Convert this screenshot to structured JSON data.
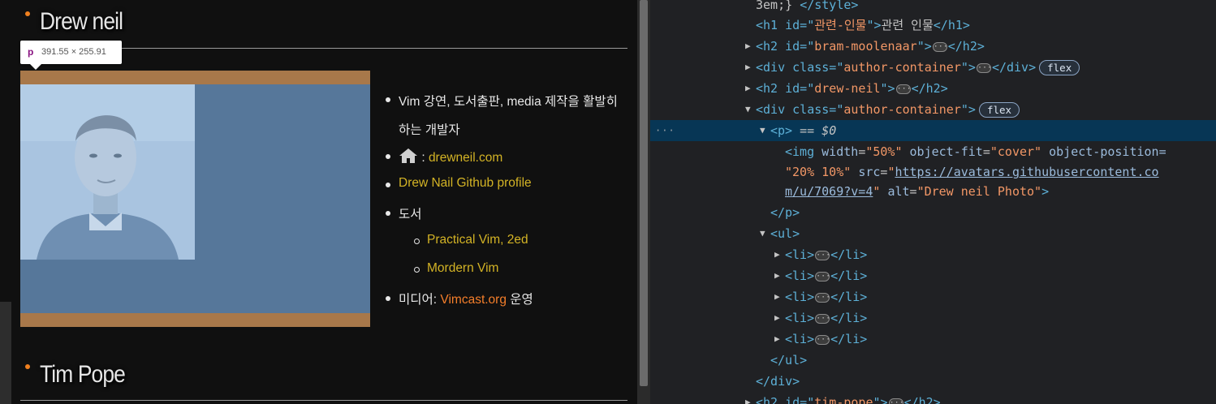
{
  "page": {
    "section1_title": "Drew neil",
    "section2_title": "Tim Pope",
    "tooltip": {
      "tag": "p",
      "dims": "391.55 × 255.91"
    },
    "list": {
      "item1_line1": "Vim 강연, 도서출판, media 제작을 활발히",
      "item1_line2": "하는 개발자",
      "item2_sep": ":",
      "item2_link": "drewneil.com",
      "item3_link": "Drew Nail Github profile",
      "item4_label": "도서",
      "sub1": "Practical Vim, 2ed",
      "sub2": "Mordern Vim",
      "item5_prefix": "미디어:",
      "item5_link": "Vimcast.org",
      "item5_suffix": "운영"
    }
  },
  "devtools": {
    "line0": {
      "text": "3em;}",
      "close_tag": "</style>"
    },
    "line1": {
      "open": "<h1 id=\"",
      "id": "관련-인물",
      "mid": "\">",
      "text": "관련 인물",
      "close": "</h1>"
    },
    "line2": {
      "open": "<h2 id=\"",
      "id": "bram-moolenaar",
      "mid": "\">",
      "close": "</h2>"
    },
    "line3": {
      "open": "<div class=\"",
      "cls": "author-container",
      "mid": "\">",
      "close": "</div>",
      "badge": "flex"
    },
    "line4": {
      "open": "<h2 id=\"",
      "id": "drew-neil",
      "mid": "\">",
      "close": "</h2>"
    },
    "line5": {
      "open": "<div class=\"",
      "cls": "author-container",
      "mid": "\">",
      "badge": "flex"
    },
    "line6": {
      "tag": "<p>",
      "eq": " == ",
      "var": "$0"
    },
    "line7": {
      "tag": "<img",
      "a1": "width",
      "v1": "\"50%\"",
      "a2": "object-fit",
      "v2": "\"cover\"",
      "a3": "object-position="
    },
    "line8": {
      "v3": "\"20% 10%\"",
      "a4": "src",
      "u1": "https://avatars.githubusercontent.co"
    },
    "line9": {
      "u2": "m/u/7069?v=4",
      "q": "\"",
      "a5": "alt",
      "v5": "\"Drew neil Photo\"",
      "end": ">"
    },
    "line10": "</p>",
    "line11": "<ul>",
    "li_open": "<li>",
    "li_close": "</li>",
    "line17": "</ul>",
    "line18": "</div>",
    "line19": {
      "open": "<h2 id=\"",
      "id": "tim-pope",
      "mid": "\">",
      "close": "</h2>"
    },
    "ellipsis": "···",
    "dots": "···"
  },
  "colors": {
    "tag": "#5db0d7",
    "attr_value": "#f29766",
    "selected_row": "#073655",
    "link": "#d3b325",
    "link_orange": "#f47e2a",
    "box_margin": "#a8784a",
    "box_content": "#56779a"
  }
}
